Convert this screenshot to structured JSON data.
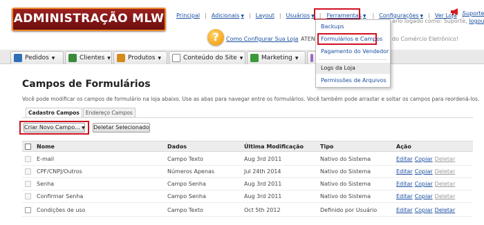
{
  "header": {
    "logo_text": "ADMINISTRAÇÃO MLW",
    "nav": [
      {
        "label": "Principal"
      },
      {
        "label": "Adicionais"
      },
      {
        "label": "Layout"
      },
      {
        "label": "Usuários"
      },
      {
        "label": "Ferramentas"
      },
      {
        "label": "Configurações"
      },
      {
        "label": "Ver Loja"
      }
    ],
    "suporte": "Suporte",
    "logged_prefix": "ário logado como:",
    "logged_user": "Suporte,",
    "logout": "logout",
    "help_link": "Como Configurar Sua Loja",
    "aten": "ATEN",
    "comercio": "do Comércio Eletrônico!"
  },
  "main_tabs": [
    {
      "label": "Pedidos",
      "icon": "cart-icon",
      "color": "#2f6fb8"
    },
    {
      "label": "Clientes",
      "icon": "users-icon",
      "color": "#3a8a3a"
    },
    {
      "label": "Produtos",
      "icon": "box-icon",
      "color": "#d68a1c"
    },
    {
      "label": "Conteúdo do Site",
      "icon": "page-icon",
      "color": "#8a8a8a"
    },
    {
      "label": "Marketing",
      "icon": "money-icon",
      "color": "#3a9a3a"
    },
    {
      "label": "",
      "icon": "stats-icon",
      "color": "#9a6ac8"
    }
  ],
  "dropdown": {
    "items": [
      {
        "label": "Backups"
      },
      {
        "label": "Formulários e Campos"
      },
      {
        "label": "Pagamento do Vendedor"
      },
      {
        "label": "Logs da Loja"
      },
      {
        "label": "Permissões de Arquivos"
      }
    ]
  },
  "page": {
    "title": "Campos de Formulários",
    "description": "Você pode modificar os campos de formulário na loja abaixo. Use as abas para navegar entre os formulários. Você também pode arrastar e soltar os campos para reordená-los.",
    "subtabs": [
      "Cadastro Campos",
      "Endereço Campos"
    ],
    "btn_new": "Criar Novo Campo...",
    "btn_delete": "Deletar Selecionado"
  },
  "table": {
    "headers": {
      "nome": "Nome",
      "dados": "Dados",
      "modificacao": "Última Modificação",
      "tipo": "Tipo",
      "acao": "Ação"
    },
    "rows": [
      {
        "nome": "E-mail",
        "dados": "Campo Texto",
        "modificacao": "Aug 3rd 2011",
        "tipo": "Nativo do Sistema"
      },
      {
        "nome": "CPF/CNPJ/Outros",
        "dados": "Números Apenas",
        "modificacao": "Jul 24th 2014",
        "tipo": "Nativo do Sistema"
      },
      {
        "nome": "Senha",
        "dados": "Campo Senha",
        "modificacao": "Aug 3rd 2011",
        "tipo": "Nativo do Sistema"
      },
      {
        "nome": "Confirmar Senha",
        "dados": "Campo Senha",
        "modificacao": "Aug 3rd 2011",
        "tipo": "Nativo do Sistema"
      },
      {
        "nome": "Condições de uso",
        "dados": "Campo Texto",
        "modificacao": "Oct 5th 2012",
        "tipo": "Definido por Usuário"
      }
    ],
    "actions": {
      "edit": "Editar",
      "copy": "Copiar",
      "delete": "Deletar"
    }
  }
}
